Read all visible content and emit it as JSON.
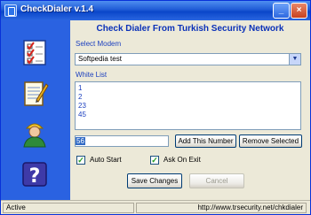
{
  "window": {
    "title": "CheckDialer v.1.4"
  },
  "heading": "Check Dialer From Turkish Security Network",
  "modem": {
    "label": "Select Modem",
    "selected": "Softpedia test"
  },
  "whitelist": {
    "label": "White List",
    "items": [
      "1",
      "2",
      "23",
      "45"
    ]
  },
  "number_input": {
    "value": "56"
  },
  "buttons": {
    "add": "Add This Number",
    "remove": "Remove Selected",
    "save": "Save Changes",
    "cancel": "Cancel"
  },
  "options": {
    "auto_start": {
      "label": "Auto Start",
      "checked": true
    },
    "ask_on_exit": {
      "label": "Ask On Exit",
      "checked": true
    }
  },
  "status": {
    "left": "Active",
    "right": "http://www.trsecurity.net/chkdialer"
  },
  "sidebar": {
    "icons": [
      "checklist-icon",
      "notepad-icon",
      "user-icon",
      "help-icon"
    ]
  },
  "colors": {
    "accent": "#0b31b8",
    "sidebar": "#2a62e1"
  }
}
